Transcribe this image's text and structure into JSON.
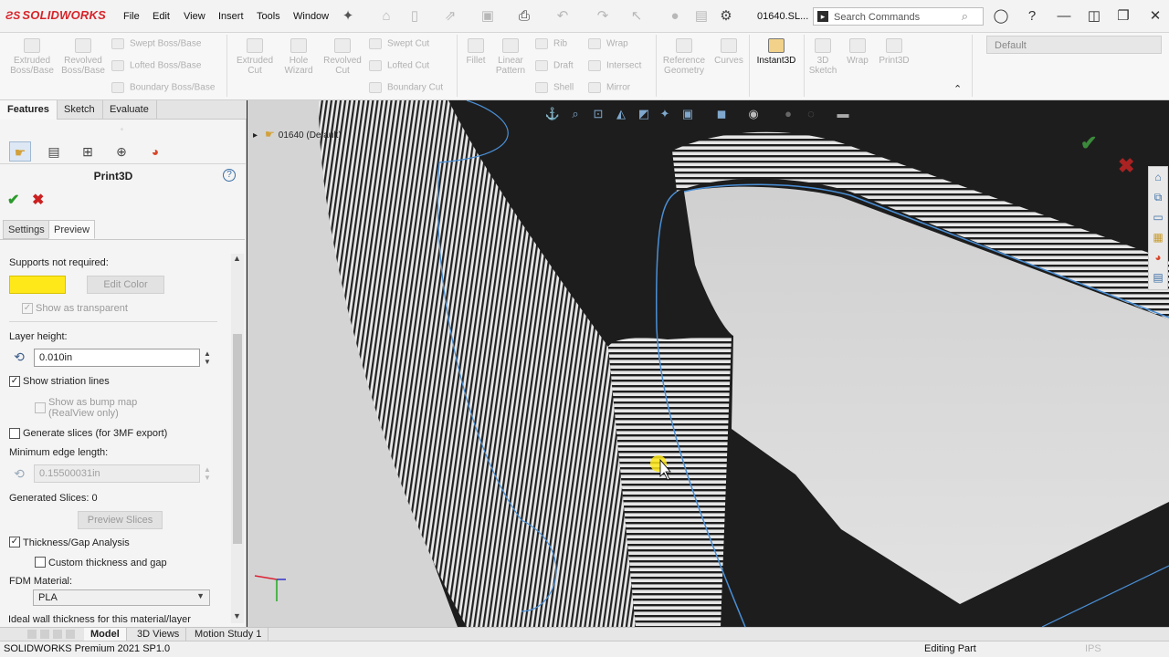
{
  "app": {
    "brand": "SOLIDWORKS",
    "document_name": "01640.SL...",
    "menu": [
      "File",
      "Edit",
      "View",
      "Insert",
      "Tools",
      "Window"
    ],
    "search_placeholder": "Search Commands"
  },
  "ribbon": {
    "buttons": [
      {
        "label1": "Extruded",
        "label2": "Boss/Base"
      },
      {
        "label1": "Revolved",
        "label2": "Boss/Base"
      },
      {
        "label1": "Extruded",
        "label2": "Cut"
      },
      {
        "label1": "Hole",
        "label2": "Wizard"
      },
      {
        "label1": "Revolved",
        "label2": "Cut"
      },
      {
        "label1": "Fillet",
        "label2": ""
      },
      {
        "label1": "Linear",
        "label2": "Pattern"
      },
      {
        "label1": "Reference",
        "label2": "Geometry"
      },
      {
        "label1": "Curves",
        "label2": ""
      },
      {
        "label1": "Instant3D",
        "label2": ""
      },
      {
        "label1": "3D",
        "label2": "Sketch"
      },
      {
        "label1": "Wrap",
        "label2": ""
      },
      {
        "label1": "Print3D",
        "label2": ""
      }
    ],
    "small": [
      "Swept Boss/Base",
      "Lofted Boss/Base",
      "Boundary Boss/Base",
      "Swept Cut",
      "Lofted Cut",
      "Boundary Cut",
      "Rib",
      "Draft",
      "Shell",
      "Wrap",
      "Intersect",
      "Mirror"
    ],
    "configuration": "Default"
  },
  "panel": {
    "tabs": [
      "Features",
      "Sketch",
      "Evaluate"
    ],
    "title": "Print3D",
    "subtabs": [
      "Settings",
      "Preview"
    ],
    "supports_label": "Supports not required:",
    "edit_color": "Edit Color",
    "show_transparent": "Show as transparent",
    "layer_height_label": "Layer height:",
    "layer_height": "0.010in",
    "show_striation": "Show striation lines",
    "bump_map1": "Show as bump map",
    "bump_map2": "(RealView only)",
    "generate_slices": "Generate slices (for 3MF export)",
    "min_edge_label": "Minimum edge length:",
    "min_edge": "0.15500031in",
    "generated_slices": "Generated Slices:  0",
    "preview_slices": "Preview Slices",
    "thickness_gap": "Thickness/Gap Analysis",
    "custom_thickness": "Custom thickness and gap",
    "fdm_label": "FDM Material:",
    "fdm_value": "PLA",
    "ideal_wall": "Ideal wall thickness for this material/layer"
  },
  "viewport": {
    "tree_item": "01640  (Default)"
  },
  "bottom_tabs": [
    "Model",
    "3D Views",
    "Motion Study 1"
  ],
  "status": {
    "left": "SOLIDWORKS Premium 2021 SP1.0",
    "editing": "Editing Part",
    "units": "IPS"
  },
  "colors": {
    "brand": "#d8232a",
    "support_swatch": "#ffe81a",
    "edge_highlight": "#4a8fd6"
  }
}
